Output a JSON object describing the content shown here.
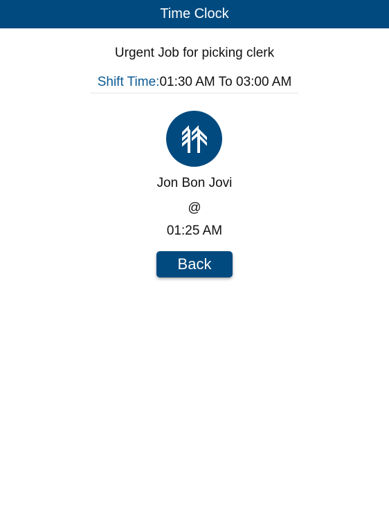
{
  "header": {
    "title": "Time Clock"
  },
  "job": {
    "title": "Urgent Job for picking clerk"
  },
  "shift": {
    "label": "Shift Time:",
    "value": "01:30 AM To 03:00 AM"
  },
  "logo": {
    "icon": "company-logo-icon"
  },
  "employee": {
    "name": "Jon Bon Jovi",
    "at": "@",
    "clock_time": "01:25 AM"
  },
  "actions": {
    "back_label": "Back"
  },
  "colors": {
    "brand": "#014a7f",
    "label_accent": "#0b5a93",
    "background": "#ffffff"
  }
}
